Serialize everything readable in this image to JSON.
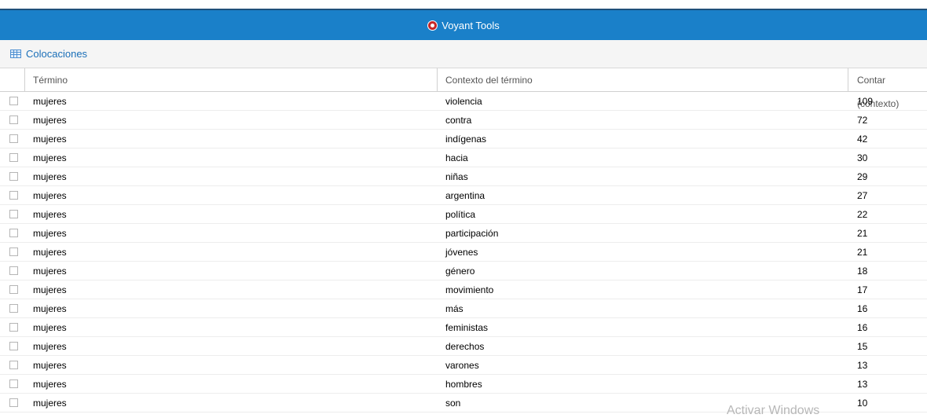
{
  "app": {
    "title": "Voyant Tools"
  },
  "panel": {
    "title": "Colocaciones"
  },
  "table": {
    "columns": [
      "Término",
      "Contexto del término",
      "Contar (contexto)"
    ],
    "rows": [
      {
        "term": "mujeres",
        "context": "violencia",
        "count": "109"
      },
      {
        "term": "mujeres",
        "context": "contra",
        "count": "72"
      },
      {
        "term": "mujeres",
        "context": "indígenas",
        "count": "42"
      },
      {
        "term": "mujeres",
        "context": "hacia",
        "count": "30"
      },
      {
        "term": "mujeres",
        "context": "niñas",
        "count": "29"
      },
      {
        "term": "mujeres",
        "context": "argentina",
        "count": "27"
      },
      {
        "term": "mujeres",
        "context": "política",
        "count": "22"
      },
      {
        "term": "mujeres",
        "context": "participación",
        "count": "21"
      },
      {
        "term": "mujeres",
        "context": "jóvenes",
        "count": "21"
      },
      {
        "term": "mujeres",
        "context": "género",
        "count": "18"
      },
      {
        "term": "mujeres",
        "context": "movimiento",
        "count": "17"
      },
      {
        "term": "mujeres",
        "context": "más",
        "count": "16"
      },
      {
        "term": "mujeres",
        "context": "feministas",
        "count": "16"
      },
      {
        "term": "mujeres",
        "context": "derechos",
        "count": "15"
      },
      {
        "term": "mujeres",
        "context": "varones",
        "count": "13"
      },
      {
        "term": "mujeres",
        "context": "hombres",
        "count": "13"
      },
      {
        "term": "mujeres",
        "context": "son",
        "count": "10"
      }
    ]
  },
  "watermark": "Activar Windows"
}
